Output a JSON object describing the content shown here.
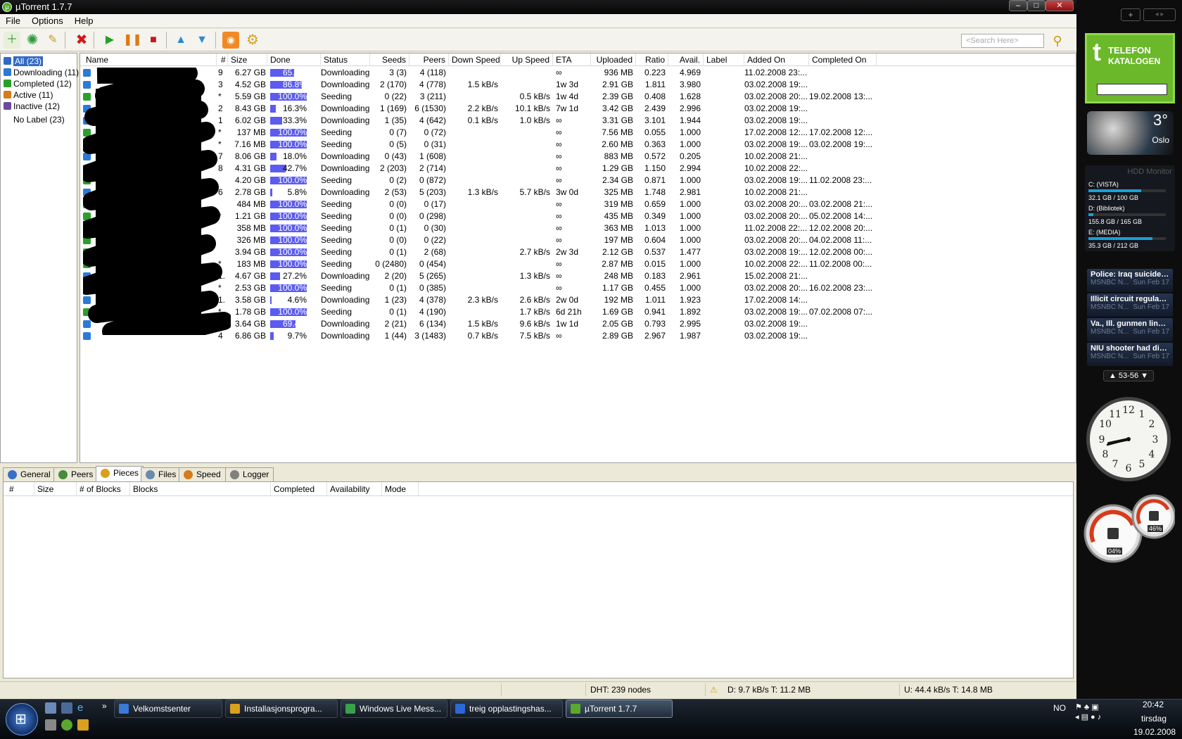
{
  "window": {
    "title": "µTorrent 1.7.7"
  },
  "menu": [
    "File",
    "Options",
    "Help"
  ],
  "toolbar": {
    "search_placeholder": "<Search Here>"
  },
  "sidebar": {
    "categories": [
      {
        "label": "All (23)",
        "color": "#316ac5"
      },
      {
        "label": "Downloading (11)",
        "color": "#2a7ad8"
      },
      {
        "label": "Completed (12)",
        "color": "#2aa02a"
      },
      {
        "label": "Active (11)",
        "color": "#d87a1a"
      },
      {
        "label": "Inactive (12)",
        "color": "#6a4aa0"
      }
    ],
    "label_item": "No Label (23)"
  },
  "list": {
    "columns": [
      "Name",
      "#",
      "Size",
      "Done",
      "Status",
      "Seeds",
      "Peers",
      "Down Speed",
      "Up Speed",
      "ETA",
      "Uploaded",
      "Ratio",
      "Avail.",
      "Label",
      "Added On",
      "Completed On"
    ],
    "rows": [
      {
        "num": "9",
        "size": "6.27 GB",
        "done": "65.1%",
        "pct": 0.651,
        "status": "Downloading",
        "seeds": "3 (3)",
        "peers": "4 (118)",
        "down": "",
        "up": "",
        "eta": "∞",
        "uploaded": "936 MB",
        "ratio": "0.223",
        "avail": "4.969",
        "added": "11.02.2008 23:...",
        "completed": ""
      },
      {
        "num": "3",
        "size": "4.52 GB",
        "done": "86.8%",
        "pct": 0.868,
        "status": "Downloading",
        "seeds": "2 (170)",
        "peers": "4 (778)",
        "down": "1.5 kB/s",
        "up": "",
        "eta": "1w 3d",
        "uploaded": "2.91 GB",
        "ratio": "1.811",
        "avail": "3.980",
        "added": "03.02.2008 19:...",
        "completed": ""
      },
      {
        "num": "*",
        "size": "5.59 GB",
        "done": "100.0%",
        "pct": 1,
        "status": "Seeding",
        "seeds": "0 (22)",
        "peers": "3 (211)",
        "down": "",
        "up": "0.5 kB/s",
        "eta": "1w 4d",
        "uploaded": "2.39 GB",
        "ratio": "0.408",
        "avail": "1.628",
        "added": "03.02.2008 20:...",
        "completed": "19.02.2008 13:..."
      },
      {
        "num": "2",
        "size": "8.43 GB",
        "done": "16.3%",
        "pct": 0.163,
        "status": "Downloading",
        "seeds": "1 (169)",
        "peers": "6 (1530)",
        "down": "2.2 kB/s",
        "up": "10.1 kB/s",
        "eta": "7w 1d",
        "uploaded": "3.42 GB",
        "ratio": "2.439",
        "avail": "2.996",
        "added": "03.02.2008 19:...",
        "completed": ""
      },
      {
        "num": "1",
        "size": "6.02 GB",
        "done": "33.3%",
        "pct": 0.333,
        "status": "Downloading",
        "seeds": "1 (35)",
        "peers": "4 (642)",
        "down": "0.1 kB/s",
        "up": "1.0 kB/s",
        "eta": "∞",
        "uploaded": "3.31 GB",
        "ratio": "3.101",
        "avail": "1.944",
        "added": "03.02.2008 19:...",
        "completed": ""
      },
      {
        "num": "*",
        "size": "137 MB",
        "done": "100.0%",
        "pct": 1,
        "status": "Seeding",
        "seeds": "0 (7)",
        "peers": "0 (72)",
        "down": "",
        "up": "",
        "eta": "∞",
        "uploaded": "7.56 MB",
        "ratio": "0.055",
        "avail": "1.000",
        "added": "17.02.2008 12:...",
        "completed": "17.02.2008 12:..."
      },
      {
        "num": "*",
        "size": "7.16 MB",
        "done": "100.0%",
        "pct": 1,
        "status": "Seeding",
        "seeds": "0 (5)",
        "peers": "0 (31)",
        "down": "",
        "up": "",
        "eta": "∞",
        "uploaded": "2.60 MB",
        "ratio": "0.363",
        "avail": "1.000",
        "added": "03.02.2008 19:...",
        "completed": "03.02.2008 19:..."
      },
      {
        "num": "7",
        "size": "8.06 GB",
        "done": "18.0%",
        "pct": 0.18,
        "status": "Downloading",
        "seeds": "0 (43)",
        "peers": "1 (608)",
        "down": "",
        "up": "",
        "eta": "∞",
        "uploaded": "883 MB",
        "ratio": "0.572",
        "avail": "0.205",
        "added": "10.02.2008 21:...",
        "completed": ""
      },
      {
        "num": "8",
        "size": "4.31 GB",
        "done": "42.7%",
        "pct": 0.427,
        "status": "Downloading",
        "seeds": "2 (203)",
        "peers": "2 (714)",
        "down": "",
        "up": "",
        "eta": "∞",
        "uploaded": "1.29 GB",
        "ratio": "1.150",
        "avail": "2.994",
        "added": "10.02.2008 22:...",
        "completed": ""
      },
      {
        "num": "",
        "size": "4.20 GB",
        "done": "100.0%",
        "pct": 1,
        "status": "Seeding",
        "seeds": "0 (2)",
        "peers": "0 (872)",
        "down": "",
        "up": "",
        "eta": "∞",
        "uploaded": "2.34 GB",
        "ratio": "0.871",
        "avail": "1.000",
        "added": "03.02.2008 19:...",
        "completed": "11.02.2008 23:..."
      },
      {
        "num": "6",
        "size": "2.78 GB",
        "done": "5.8%",
        "pct": 0.058,
        "status": "Downloading",
        "seeds": "2 (53)",
        "peers": "5 (203)",
        "down": "1.3 kB/s",
        "up": "5.7 kB/s",
        "eta": "3w 0d",
        "uploaded": "325 MB",
        "ratio": "1.748",
        "avail": "2.981",
        "added": "10.02.2008 21:...",
        "completed": ""
      },
      {
        "num": "",
        "size": "484 MB",
        "done": "100.0%",
        "pct": 1,
        "status": "Seeding",
        "seeds": "0 (0)",
        "peers": "0 (17)",
        "down": "",
        "up": "",
        "eta": "∞",
        "uploaded": "319 MB",
        "ratio": "0.659",
        "avail": "1.000",
        "added": "03.02.2008 20:...",
        "completed": "03.02.2008 21:..."
      },
      {
        "num": "*",
        "size": "1.21 GB",
        "done": "100.0%",
        "pct": 1,
        "status": "Seeding",
        "seeds": "0 (0)",
        "peers": "0 (298)",
        "down": "",
        "up": "",
        "eta": "∞",
        "uploaded": "435 MB",
        "ratio": "0.349",
        "avail": "1.000",
        "added": "03.02.2008 20:...",
        "completed": "05.02.2008 14:..."
      },
      {
        "num": "",
        "size": "358 MB",
        "done": "100.0%",
        "pct": 1,
        "status": "Seeding",
        "seeds": "0 (1)",
        "peers": "0 (30)",
        "down": "",
        "up": "",
        "eta": "∞",
        "uploaded": "363 MB",
        "ratio": "1.013",
        "avail": "1.000",
        "added": "11.02.2008 22:...",
        "completed": "12.02.2008 20:..."
      },
      {
        "num": "",
        "size": "326 MB",
        "done": "100.0%",
        "pct": 1,
        "status": "Seeding",
        "seeds": "0 (0)",
        "peers": "0 (22)",
        "down": "",
        "up": "",
        "eta": "∞",
        "uploaded": "197 MB",
        "ratio": "0.604",
        "avail": "1.000",
        "added": "03.02.2008 20:...",
        "completed": "04.02.2008 11:..."
      },
      {
        "num": "",
        "size": "3.94 GB",
        "done": "100.0%",
        "pct": 1,
        "status": "Seeding",
        "seeds": "0 (1)",
        "peers": "2 (68)",
        "down": "",
        "up": "2.7 kB/s",
        "eta": "2w 3d",
        "uploaded": "2.12 GB",
        "ratio": "0.537",
        "avail": "1.477",
        "added": "03.02.2008 19:...",
        "completed": "12.02.2008 00:..."
      },
      {
        "num": "*",
        "size": "183 MB",
        "done": "100.0%",
        "pct": 1,
        "status": "Seeding",
        "seeds": "0 (2480)",
        "peers": "0 (454)",
        "down": "",
        "up": "",
        "eta": "∞",
        "uploaded": "2.87 MB",
        "ratio": "0.015",
        "avail": "1.000",
        "added": "10.02.2008 22:...",
        "completed": "11.02.2008 00:..."
      },
      {
        "num": "1.",
        "size": "4.67 GB",
        "done": "27.2%",
        "pct": 0.272,
        "status": "Downloading",
        "seeds": "2 (20)",
        "peers": "5 (265)",
        "down": "",
        "up": "1.3 kB/s",
        "eta": "∞",
        "uploaded": "248 MB",
        "ratio": "0.183",
        "avail": "2.961",
        "added": "15.02.2008 21:...",
        "completed": ""
      },
      {
        "num": "*",
        "size": "2.53 GB",
        "done": "100.0%",
        "pct": 1,
        "status": "Seeding",
        "seeds": "0 (1)",
        "peers": "0 (385)",
        "down": "",
        "up": "",
        "eta": "∞",
        "uploaded": "1.17 GB",
        "ratio": "0.455",
        "avail": "1.000",
        "added": "03.02.2008 20:...",
        "completed": "16.02.2008 23:..."
      },
      {
        "num": "1.",
        "size": "3.58 GB",
        "done": "4.6%",
        "pct": 0.046,
        "status": "Downloading",
        "seeds": "1 (23)",
        "peers": "4 (378)",
        "down": "2.3 kB/s",
        "up": "2.6 kB/s",
        "eta": "2w 0d",
        "uploaded": "192 MB",
        "ratio": "1.011",
        "avail": "1.923",
        "added": "17.02.2008 14:...",
        "completed": ""
      },
      {
        "num": "*",
        "size": "1.78 GB",
        "done": "100.0%",
        "pct": 1,
        "status": "Seeding",
        "seeds": "0 (1)",
        "peers": "4 (190)",
        "down": "",
        "up": "1.7 kB/s",
        "eta": "6d 21h",
        "uploaded": "1.69 GB",
        "ratio": "0.941",
        "avail": "1.892",
        "added": "03.02.2008 19:...",
        "completed": "07.02.2008 07:..."
      },
      {
        "num": "5",
        "size": "3.64 GB",
        "done": "69.4%",
        "pct": 0.694,
        "status": "Downloading",
        "seeds": "2 (21)",
        "peers": "6 (134)",
        "down": "1.5 kB/s",
        "up": "9.6 kB/s",
        "eta": "1w 1d",
        "uploaded": "2.05 GB",
        "ratio": "0.793",
        "avail": "2.995",
        "added": "03.02.2008 19:...",
        "completed": ""
      },
      {
        "num": "4",
        "size": "6.86 GB",
        "done": "9.7%",
        "pct": 0.097,
        "status": "Downloading",
        "seeds": "1 (44)",
        "peers": "3 (1483)",
        "down": "0.7 kB/s",
        "up": "7.5 kB/s",
        "eta": "∞",
        "uploaded": "2.89 GB",
        "ratio": "2.967",
        "avail": "1.987",
        "added": "03.02.2008 19:...",
        "completed": ""
      }
    ]
  },
  "tabs": [
    {
      "label": "General",
      "color": "#3a6fc7"
    },
    {
      "label": "Peers",
      "color": "#4a8a3a"
    },
    {
      "label": "Pieces",
      "color": "#d8a020"
    },
    {
      "label": "Files",
      "color": "#6a8ab0"
    },
    {
      "label": "Speed",
      "color": "#d87a1a"
    },
    {
      "label": "Logger",
      "color": "#808080"
    }
  ],
  "pieces_columns": [
    "#",
    "Size",
    "# of Blocks",
    "Blocks",
    "Completed",
    "Availability",
    "Mode"
  ],
  "status": {
    "dht": "DHT: 239 nodes",
    "down": "D: 9.7 kB/s T: 11.2 MB",
    "up": "U: 44.4 kB/s T: 14.8 MB"
  },
  "gadgets": {
    "telefon": [
      "TELEFON",
      "KATALOGEN"
    ],
    "weather": {
      "temp": "3°",
      "city": "Oslo"
    },
    "hdd": {
      "title": "HDD Monitor",
      "drives": [
        {
          "name": "C: (VISTA)",
          "usage": "32.1 GB / 100 GB",
          "used": 0.68
        },
        {
          "name": "D: (Bibliotek)",
          "usage": "155.8 GB / 165 GB",
          "used": 0.06
        },
        {
          "name": "E: (MEDIA)",
          "usage": "35.3 GB / 212 GB",
          "used": 0.83
        }
      ]
    },
    "news": [
      {
        "headline": "Police: Iraq suicide b...",
        "source": "MSNBC N...",
        "date": "Sun Feb 17"
      },
      {
        "headline": "Illicit circuit regularly...",
        "source": "MSNBC N...",
        "date": "Sun Feb 17"
      },
      {
        "headline": "Va., Ill. gunmen linke...",
        "source": "MSNBC N...",
        "date": "Sun Feb 17"
      },
      {
        "headline": "NIU shooter had dist...",
        "source": "MSNBC N...",
        "date": "Sun Feb 17"
      }
    ],
    "news_pager": "53-56",
    "meters": {
      "cpu": "04%",
      "mem": "46%"
    }
  },
  "taskbar": {
    "buttons": [
      {
        "label": "Velkomstsenter",
        "color": "#3a7ad8"
      },
      {
        "label": "Installasjonsprogra...",
        "color": "#d8a020"
      },
      {
        "label": "Windows Live Mess...",
        "color": "#3aa04a"
      },
      {
        "label": "treig opplastingshas...",
        "color": "#2a6ad8"
      },
      {
        "label": "µTorrent 1.7.7",
        "color": "#5aa82e"
      }
    ],
    "lang": "NO",
    "time": "20:42",
    "day": "tirsdag",
    "date": "19.02.2008"
  }
}
